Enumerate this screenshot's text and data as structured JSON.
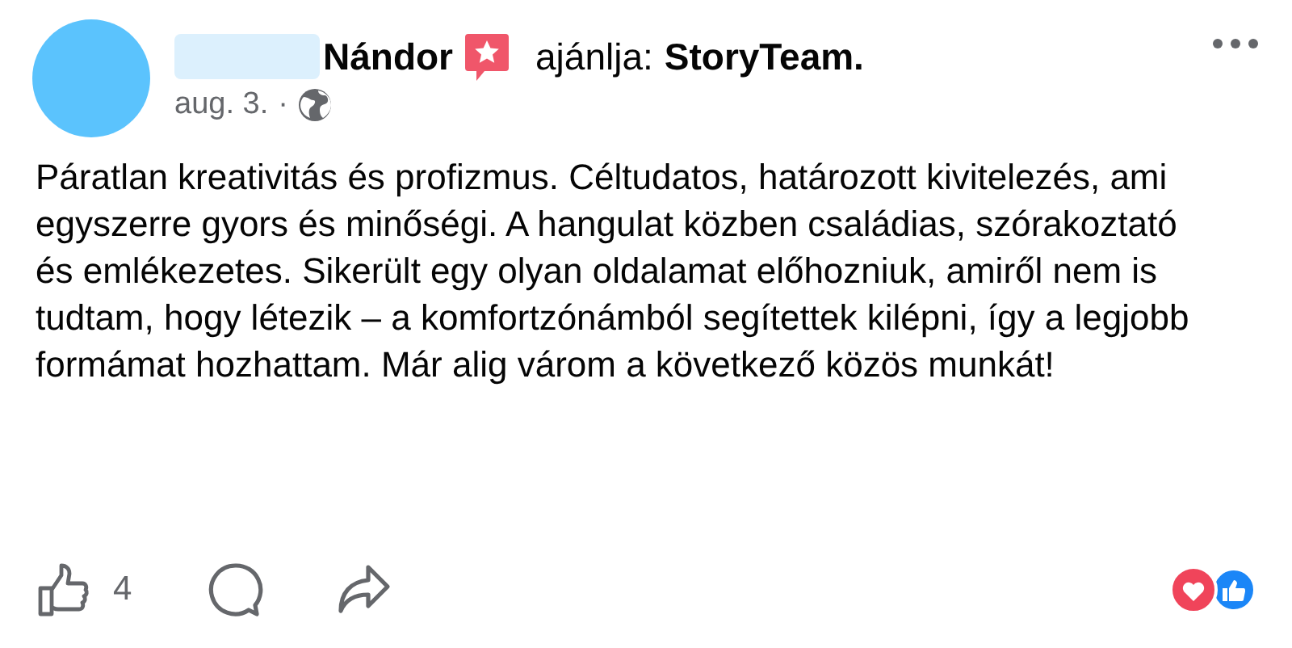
{
  "post": {
    "author": "Nándor",
    "recommends_label": "ajánlja:",
    "page": "StoryTeam.",
    "date": "aug. 3.",
    "separator": "·",
    "text": "Páratlan kreativitás és profizmus. Céltudatos, határozott kivitelezés, ami egyszerre gyors és minőségi. A hangulat közben családias, szórakoztató és emlékezetes. Sikerült egy olyan oldalamat előhozniuk, amiről nem is tudtam, hogy létezik – a komfortzónámból segítettek kilépni, így a legjobb formámat hozhattam. Már alig várom a következő közös munkát!"
  },
  "actions": {
    "like_count": "4"
  }
}
